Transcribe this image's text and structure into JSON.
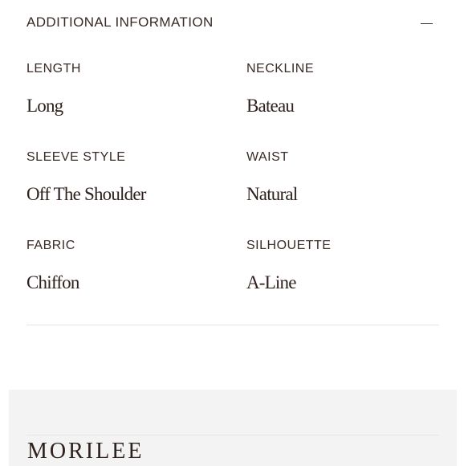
{
  "section": {
    "title": "ADDITIONAL INFORMATION",
    "collapse_icon": "minus-icon"
  },
  "attributes": [
    {
      "label": "LENGTH",
      "value": "Long"
    },
    {
      "label": "NECKLINE",
      "value": "Bateau"
    },
    {
      "label": "SLEEVE STYLE",
      "value": "Off The Shoulder"
    },
    {
      "label": "WAIST",
      "value": "Natural"
    },
    {
      "label": "FABRIC",
      "value": "Chiffon"
    },
    {
      "label": "SILHOUETTE",
      "value": "A-Line"
    }
  ],
  "footer": {
    "logo_text": "MORILEE"
  },
  "colors": {
    "text": "#3a2a26",
    "divider": "#e4e4e4",
    "footer_background": "#f3f3f3"
  }
}
